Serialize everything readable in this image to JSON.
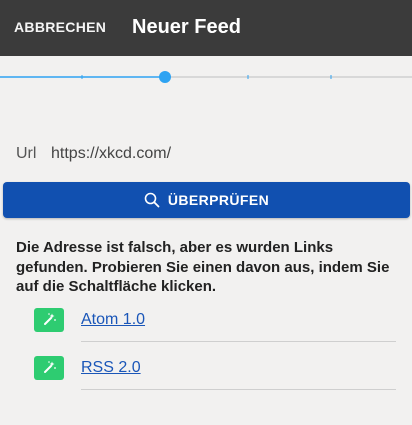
{
  "appbar": {
    "cancel_label": "ABBRECHEN",
    "title": "Neuer Feed"
  },
  "stepper": {
    "steps": 5,
    "current_step": 3,
    "active_color": "#2ea3f2",
    "inactive_color": "#cfcfcf"
  },
  "form": {
    "url_label": "Url",
    "url_value": "https://xkcd.com/",
    "check_button_label": "ÜBERPRÜFEN",
    "check_icon": "search-icon"
  },
  "message": "Die Adresse ist falsch, aber es wurden Links gefunden. Probieren Sie einen davon aus, indem Sie auf die Schaltfläche klicken.",
  "feeds": [
    {
      "label": "Atom 1.0",
      "icon": "magic-wand-icon"
    },
    {
      "label": "RSS 2.0",
      "icon": "magic-wand-icon"
    }
  ],
  "colors": {
    "appbar": "#3b3b3b",
    "primary_button": "#1150b0",
    "feed_icon_bg": "#2ecc71",
    "link": "#1a56b8"
  }
}
